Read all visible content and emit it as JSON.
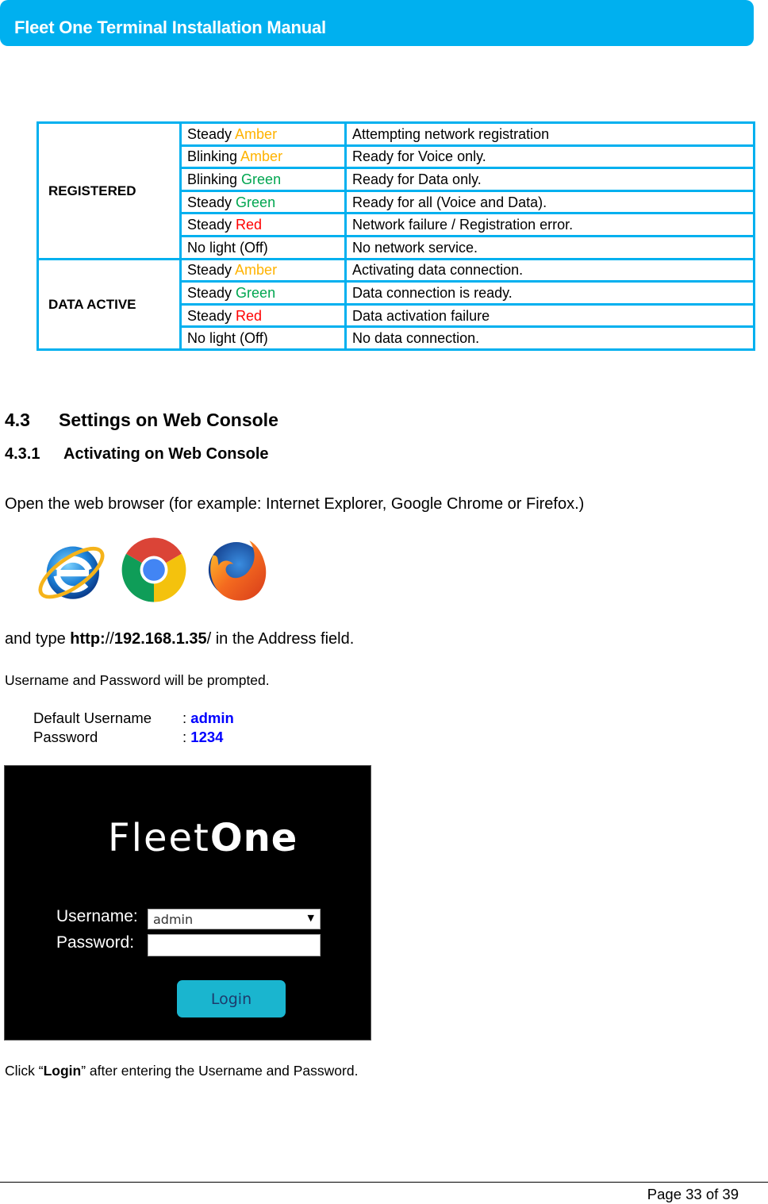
{
  "header": {
    "title": "Fleet One Terminal Installation Manual",
    "bar_color": "#00b0ef"
  },
  "led_table": {
    "colors": {
      "amber": "#ffb300",
      "green": "#00a650",
      "red": "#ff0000"
    },
    "groups": [
      {
        "name": "REGISTERED",
        "rows": [
          {
            "state_prefix": "Steady ",
            "state_color_word": "Amber",
            "color": "amber",
            "meaning": "Attempting network registration"
          },
          {
            "state_prefix": "Blinking ",
            "state_color_word": "Amber",
            "color": "amber",
            "meaning": "Ready for Voice only."
          },
          {
            "state_prefix": "Blinking ",
            "state_color_word": "Green",
            "color": "green",
            "meaning": "Ready for Data only."
          },
          {
            "state_prefix": "Steady ",
            "state_color_word": "Green",
            "color": "green",
            "meaning": "Ready for all (Voice and Data)."
          },
          {
            "state_prefix": "Steady ",
            "state_color_word": "Red",
            "color": "red",
            "meaning": "Network failure / Registration error."
          },
          {
            "state_prefix": "No light (Off)",
            "state_color_word": "",
            "color": "",
            "meaning": "No network service."
          }
        ]
      },
      {
        "name": "DATA ACTIVE",
        "rows": [
          {
            "state_prefix": "Steady ",
            "state_color_word": "Amber",
            "color": "amber",
            "meaning": "Activating data connection."
          },
          {
            "state_prefix": "Steady ",
            "state_color_word": "Green",
            "color": "green",
            "meaning": "Data connection is ready."
          },
          {
            "state_prefix": "Steady ",
            "state_color_word": "Red",
            "color": "red",
            "meaning": "Data activation failure"
          },
          {
            "state_prefix": "No light (Off)",
            "state_color_word": "",
            "color": "",
            "meaning": "No data connection."
          }
        ]
      }
    ]
  },
  "section": {
    "number": "4.3",
    "title": "Settings on Web Console"
  },
  "subsection": {
    "number": "4.3.1",
    "title": "Activating on Web Console"
  },
  "paragraphs": {
    "open_browser": "Open the web browser (for example: Internet Explorer, Google Chrome or Firefox.)",
    "type_prefix": "and type ",
    "type_url_bold_a": "http:",
    "type_url_plain": "//",
    "type_url_bold_b": "192.168.1.35",
    "type_suffix": "/ in the Address field.",
    "prompted": "Username and Password will be prompted.",
    "click_prefix": "Click “",
    "click_bold": "Login",
    "click_suffix": "” after entering the Username and Password."
  },
  "browsers": [
    {
      "name": "Internet Explorer",
      "icon": "internet-explorer-icon"
    },
    {
      "name": "Google Chrome",
      "icon": "chrome-icon"
    },
    {
      "name": "Firefox",
      "icon": "firefox-icon"
    }
  ],
  "credentials": {
    "username_label": "Default Username",
    "username_value": ": ",
    "username": "admin",
    "password_label": "Password",
    "password_value": ": ",
    "password": "1234"
  },
  "login_screen": {
    "brand_light": "Fleet",
    "brand_bold": "One",
    "username_label": "Username:",
    "username_selected": "admin",
    "password_label": "Password:",
    "password_value": "",
    "login_button": "Login"
  },
  "footer": {
    "page_label": "Page 33 of 39"
  }
}
